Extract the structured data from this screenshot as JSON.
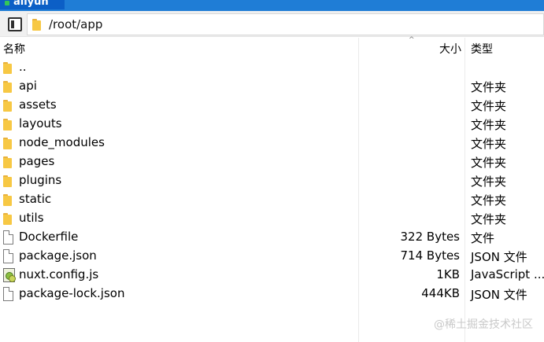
{
  "session_tab": {
    "label": "aliyun"
  },
  "path_bar": {
    "path": "/root/app"
  },
  "columns": {
    "name": "名称",
    "size": "大小",
    "type": "类型"
  },
  "files": [
    {
      "name": "..",
      "size": "",
      "type": "",
      "icon": "folder-icon"
    },
    {
      "name": "api",
      "size": "",
      "type": "文件夹",
      "icon": "folder-icon"
    },
    {
      "name": "assets",
      "size": "",
      "type": "文件夹",
      "icon": "folder-icon"
    },
    {
      "name": "layouts",
      "size": "",
      "type": "文件夹",
      "icon": "folder-icon"
    },
    {
      "name": "node_modules",
      "size": "",
      "type": "文件夹",
      "icon": "folder-icon"
    },
    {
      "name": "pages",
      "size": "",
      "type": "文件夹",
      "icon": "folder-icon"
    },
    {
      "name": "plugins",
      "size": "",
      "type": "文件夹",
      "icon": "folder-icon"
    },
    {
      "name": "static",
      "size": "",
      "type": "文件夹",
      "icon": "folder-icon"
    },
    {
      "name": "utils",
      "size": "",
      "type": "文件夹",
      "icon": "folder-icon"
    },
    {
      "name": "Dockerfile",
      "size": "322 Bytes",
      "type": "文件",
      "icon": "file-icon"
    },
    {
      "name": "package.json",
      "size": "714 Bytes",
      "type": "JSON 文件",
      "icon": "file-icon"
    },
    {
      "name": "nuxt.config.js",
      "size": "1KB",
      "type": "JavaScript ...",
      "icon": "script-icon"
    },
    {
      "name": "package-lock.json",
      "size": "444KB",
      "type": "JSON 文件",
      "icon": "file-icon"
    }
  ],
  "watermark": "@稀土掘金技术社区",
  "colors": {
    "tab": "#0c5fc6",
    "folder": "#f7c844"
  }
}
